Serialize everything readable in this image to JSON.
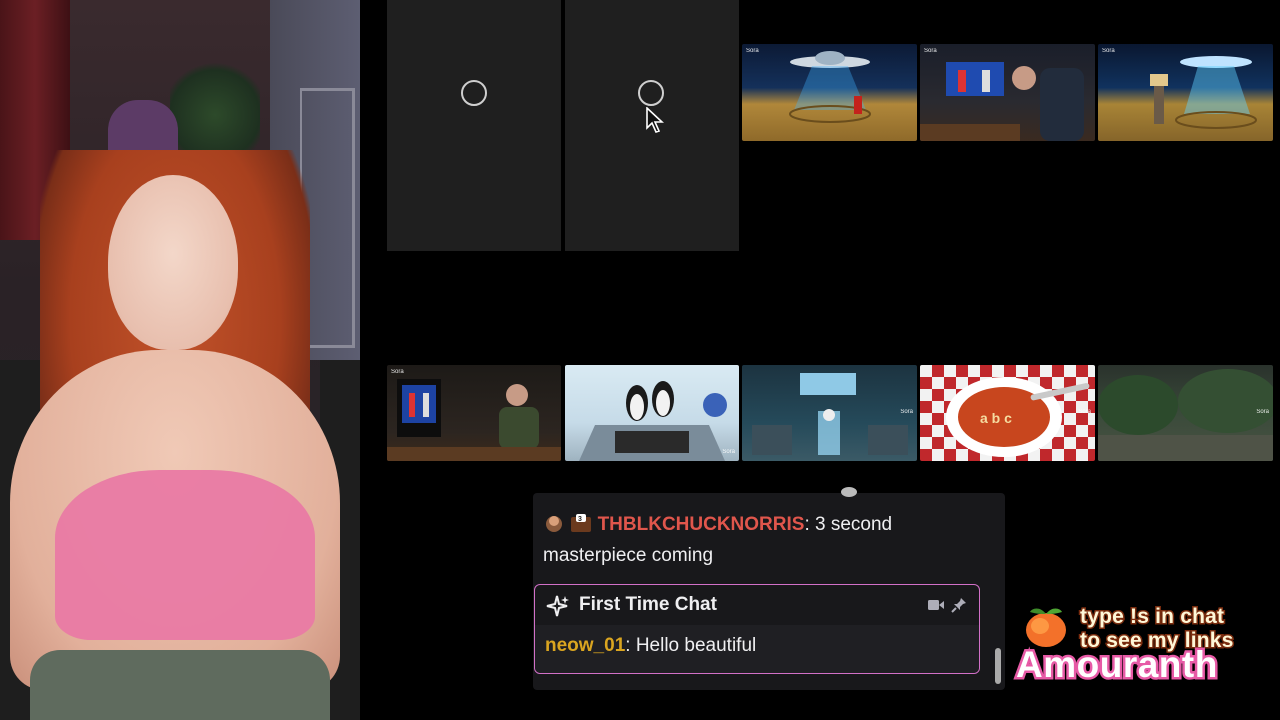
{
  "chat": {
    "message": {
      "username": "THBLKCHUCKNORRIS",
      "text": ": 3 second masterpiece coming"
    },
    "first_time_chat": {
      "title": "First Time Chat",
      "username": "neow_01",
      "text": ": Hello beautiful"
    }
  },
  "thumbnails_top": [
    {
      "badge": "Sora"
    },
    {
      "badge": "Sora"
    },
    {
      "badge": "Sora"
    }
  ],
  "thumbnails_bottom": [
    {
      "badge": "Sora"
    },
    {
      "badge": "Sora"
    },
    {
      "badge": "Sora"
    },
    {
      "badge": "Sora"
    },
    {
      "badge": "Sora"
    }
  ],
  "overlay": {
    "line1": "type !s in chat",
    "line2": "to see my links",
    "brand": "Amouranth"
  },
  "colors": {
    "chat_bg": "#18181b",
    "username_red": "#e0564c",
    "username_gold": "#daa520",
    "first_time_border": "#d270c8",
    "brand_stroke": "#e75aa6"
  },
  "icons": [
    "spinner-icon",
    "cursor-icon",
    "sparkle-icon",
    "camera-icon",
    "pin-icon",
    "peach-icon",
    "emote-icon"
  ]
}
